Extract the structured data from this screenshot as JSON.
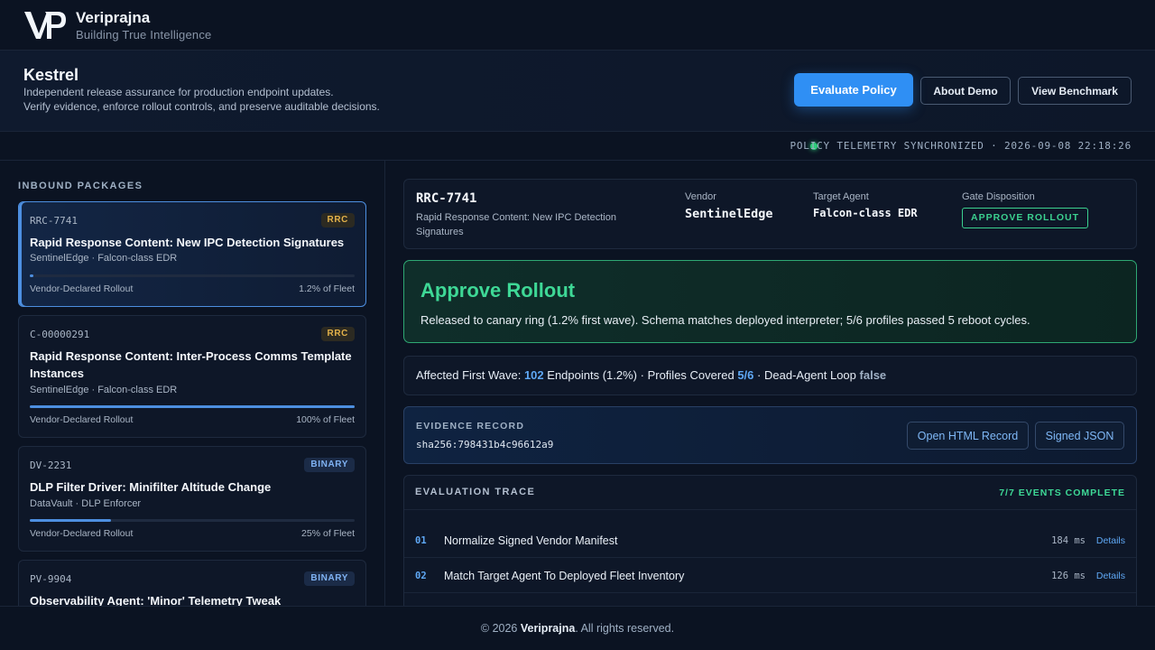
{
  "brand": {
    "name": "Veriprajna",
    "tagline": "Building True Intelligence"
  },
  "app": {
    "title": "Kestrel",
    "subtitle_line1": "Independent release assurance for production endpoint updates.",
    "subtitle_line2": "Verify evidence, enforce rollout controls, and preserve auditable decisions.",
    "buttons": {
      "evaluate": "Evaluate Policy",
      "about": "About Demo",
      "benchmark": "View Benchmark"
    }
  },
  "status": {
    "text": "POLICY TELEMETRY SYNCHRONIZED · 2026-09-08 22:18:26",
    "color": "#2ecc7a"
  },
  "inbound": {
    "label": "INBOUND PACKAGES",
    "packages": [
      {
        "id": "RRC-7741",
        "badge": "RRC",
        "title": "Rapid Response Content: New IPC Detection Signatures",
        "vendor": "SentinelEdge · Falcon-class EDR",
        "rollout_label": "Vendor-Declared Rollout",
        "rollout_value": "1.2% of Fleet",
        "rollout_fraction": 0.012
      },
      {
        "id": "C-00000291",
        "badge": "RRC",
        "title": "Rapid Response Content: Inter-Process Comms Template Instances",
        "vendor": "SentinelEdge · Falcon-class EDR",
        "rollout_label": "Vendor-Declared Rollout",
        "rollout_value": "100% of Fleet",
        "rollout_fraction": 1.0
      },
      {
        "id": "DV-2231",
        "badge": "BINARY",
        "title": "DLP Filter Driver: Minifilter Altitude Change",
        "vendor": "DataVault · DLP Enforcer",
        "rollout_label": "Vendor-Declared Rollout",
        "rollout_value": "25% of Fleet",
        "rollout_fraction": 0.25
      },
      {
        "id": "PV-9904",
        "badge": "BINARY",
        "title": "Observability Agent: 'Minor' Telemetry Tweak"
      }
    ]
  },
  "summary": {
    "id": "RRC-7741",
    "description": "Rapid Response Content: New IPC Detection Signatures",
    "vendor_label": "Vendor",
    "vendor": "SentinelEdge",
    "target_label": "Target Agent",
    "target": "Falcon-class EDR",
    "gate_label": "Gate Disposition",
    "gate": "APPROVE ROLLOUT"
  },
  "verdict": {
    "title": "Approve Rollout",
    "text": "Released to canary ring (1.2% first wave). Schema matches deployed interpreter; 5/6 profiles passed 5 reboot cycles."
  },
  "impact": {
    "wave_label": "Affected First Wave:",
    "wave_value": "102",
    "wave_suffix": "Endpoints (1.2%) ·",
    "profiles_label": "Profiles Covered",
    "profiles_value": "5/6",
    "sep": "·",
    "loop_label": "Dead-Agent Loop",
    "loop_value": "false"
  },
  "evidence": {
    "label": "EVIDENCE RECORD",
    "hash": "sha256:798431b4c96612a9",
    "open_html": "Open HTML Record",
    "signed_json": "Signed JSON"
  },
  "trace": {
    "title": "EVALUATION TRACE",
    "count": "7/7 EVENTS COMPLETE",
    "rows": [
      {
        "num": "01",
        "name": "Normalize Signed Vendor Manifest",
        "ms": "184 ms",
        "details": "Details"
      },
      {
        "num": "02",
        "name": "Match Target Agent To Deployed Fleet Inventory",
        "ms": "126 ms",
        "details": "Details"
      }
    ]
  },
  "footer": {
    "prefix": "© 2026",
    "brand": "Veriprajna",
    "suffix": ". All rights reserved."
  }
}
